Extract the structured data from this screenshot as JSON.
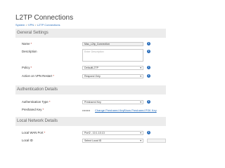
{
  "header": {
    "title": "L2TP Connections",
    "breadcrumb": {
      "part1": "System",
      "part2": "VPN",
      "part3": "L2TP Connections"
    }
  },
  "sections": {
    "general": "General Settings",
    "auth": "Authentication Details",
    "local": "Local Network Details"
  },
  "fields": {
    "name": {
      "label": "Name",
      "value": "Mac_L2tp_Connection"
    },
    "description": {
      "label": "Description",
      "placeholder": "Enter Description"
    },
    "policy": {
      "label": "Policy",
      "value": "DefaultL2TP"
    },
    "action_on_restart": {
      "label": "Action on VPN Restart",
      "value": "Respond Only"
    },
    "auth_type": {
      "label": "Authentication Type",
      "value": "Preshared Key"
    },
    "preshared_key": {
      "label": "Preshared Key",
      "masked": "••••••••",
      "change_link": "Change Preshared Key",
      "show_link": "Show Preshared PSK Key"
    },
    "local_wan_port": {
      "label": "Local WAN Port",
      "value": "Port2 - 10.1.10.13"
    },
    "local_id": {
      "label": "Local ID",
      "value": "Select Local ID"
    }
  },
  "symbols": {
    "required": "*",
    "separator": " > ",
    "chevron": "▾",
    "info": "i"
  },
  "colors": {
    "accent": "#2a6ebb",
    "section_bg": "#ececec",
    "required": "#c0392b"
  }
}
